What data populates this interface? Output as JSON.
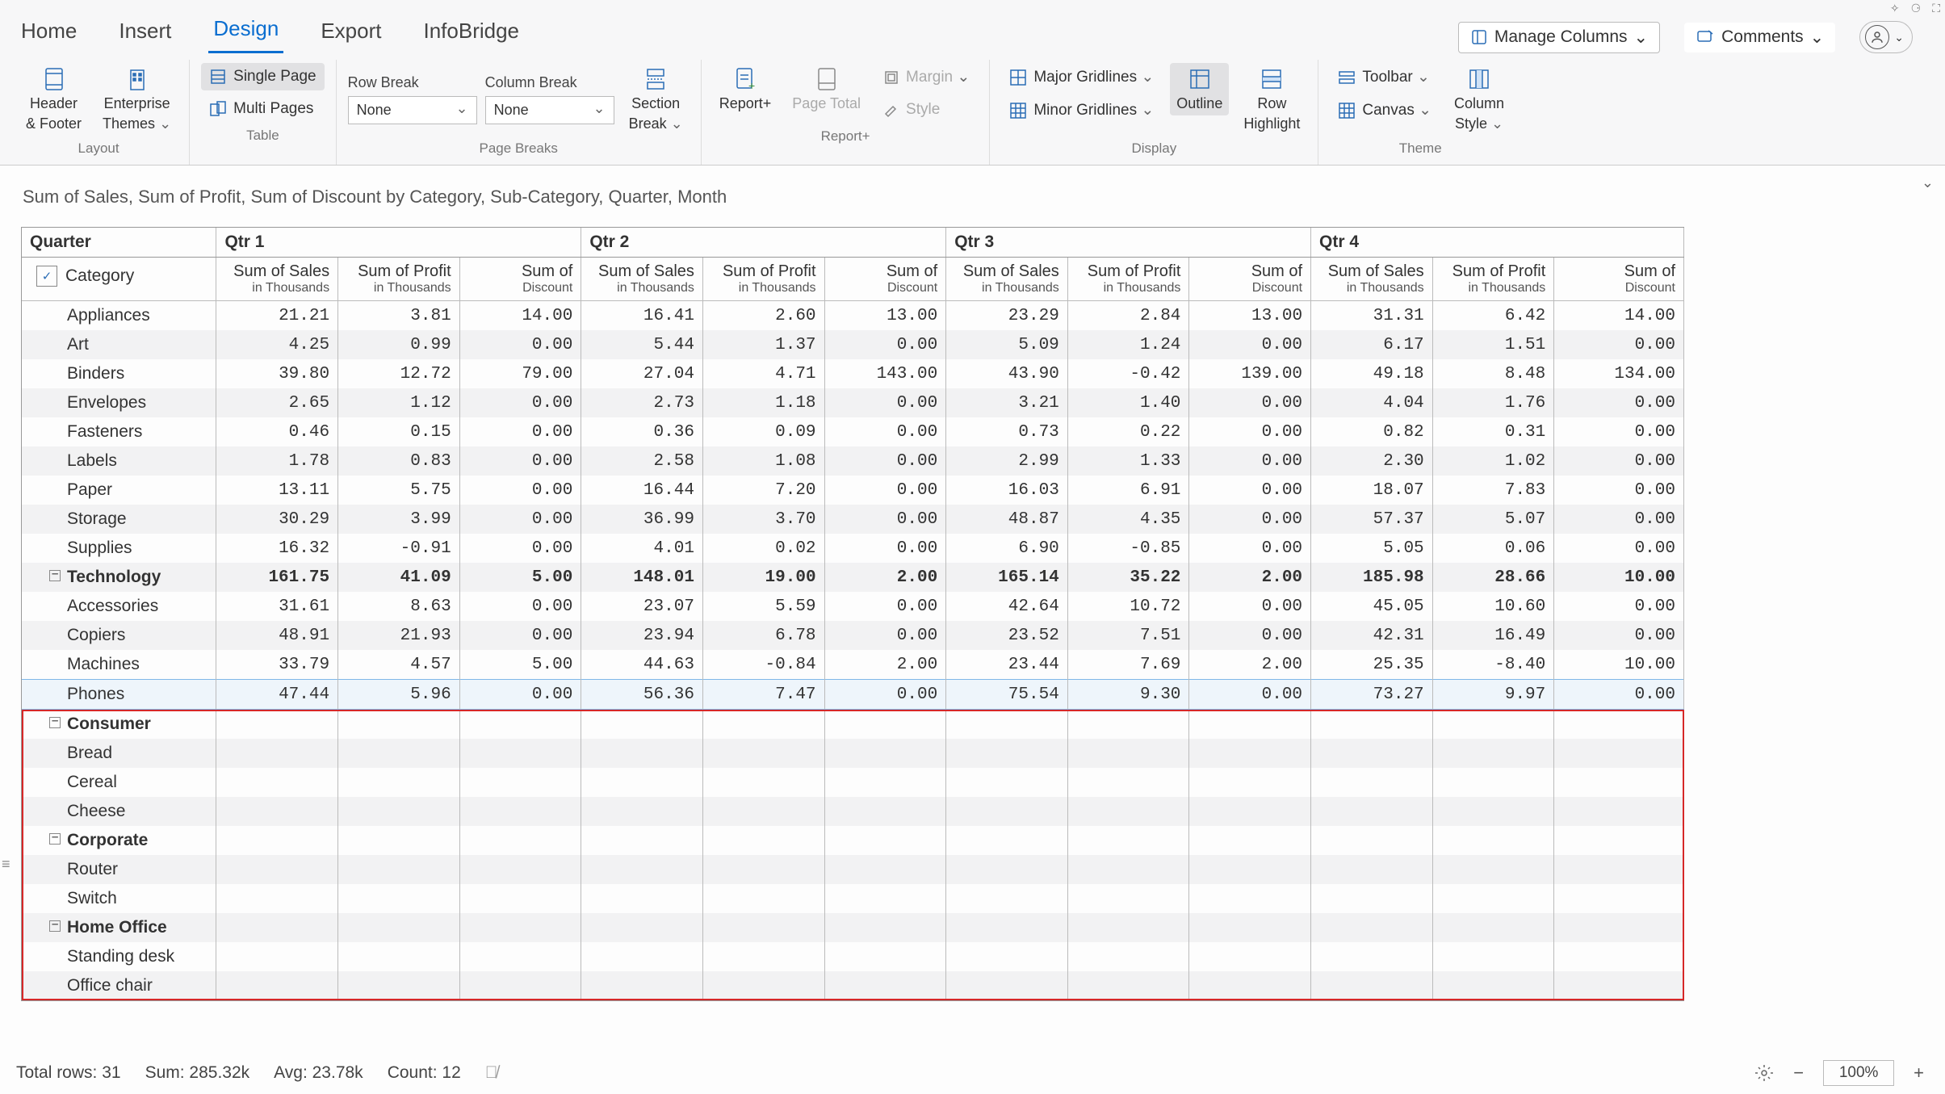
{
  "tabs": [
    "Home",
    "Insert",
    "Design",
    "Export",
    "InfoBridge"
  ],
  "active_tab": "Design",
  "top_controls": {
    "manage_columns": "Manage Columns",
    "comments": "Comments"
  },
  "ribbon": {
    "layout": {
      "header_footer": [
        "Header",
        "& Footer"
      ],
      "enterprise_themes": [
        "Enterprise",
        "Themes"
      ],
      "label": "Layout"
    },
    "table": {
      "single_page": "Single Page",
      "multi_pages": "Multi Pages",
      "label": "Table"
    },
    "page_breaks": {
      "row_break": "Row Break",
      "column_break": "Column Break",
      "none1": "None",
      "none2": "None",
      "section_break": [
        "Section",
        "Break"
      ],
      "label": "Page Breaks"
    },
    "report_plus": {
      "report": "Report+",
      "page_total": "Page Total",
      "margin": "Margin",
      "style": "Style",
      "label": "Report+"
    },
    "display": {
      "major": "Major Gridlines",
      "minor": "Minor Gridlines",
      "outline": "Outline",
      "row_highlight": [
        "Row",
        "Highlight"
      ],
      "label": "Display"
    },
    "theme": {
      "toolbar": "Toolbar",
      "canvas": "Canvas",
      "column_style": [
        "Column",
        "Style"
      ],
      "label": "Theme"
    }
  },
  "report_title": "Sum of Sales, Sum of Profit, Sum of Discount by Category, Sub-Category, Quarter, Month",
  "quarter_label": "Quarter",
  "category_label": "Category",
  "quarters": [
    "Qtr 1",
    "Qtr 2",
    "Qtr 3",
    "Qtr 4"
  ],
  "measures": [
    {
      "t": "Sum of Sales",
      "s": "in Thousands"
    },
    {
      "t": "Sum of Profit",
      "s": "in Thousands"
    },
    {
      "t": "Sum of",
      "s": "Discount"
    }
  ],
  "rows": [
    {
      "label": "Appliances",
      "lvl": 1,
      "v": [
        "21.21",
        "3.81",
        "14.00",
        "16.41",
        "2.60",
        "13.00",
        "23.29",
        "2.84",
        "13.00",
        "31.31",
        "6.42",
        "14.00"
      ]
    },
    {
      "label": "Art",
      "lvl": 1,
      "v": [
        "4.25",
        "0.99",
        "0.00",
        "5.44",
        "1.37",
        "0.00",
        "5.09",
        "1.24",
        "0.00",
        "6.17",
        "1.51",
        "0.00"
      ]
    },
    {
      "label": "Binders",
      "lvl": 1,
      "v": [
        "39.80",
        "12.72",
        "79.00",
        "27.04",
        "4.71",
        "143.00",
        "43.90",
        "-0.42",
        "139.00",
        "49.18",
        "8.48",
        "134.00"
      ]
    },
    {
      "label": "Envelopes",
      "lvl": 1,
      "v": [
        "2.65",
        "1.12",
        "0.00",
        "2.73",
        "1.18",
        "0.00",
        "3.21",
        "1.40",
        "0.00",
        "4.04",
        "1.76",
        "0.00"
      ]
    },
    {
      "label": "Fasteners",
      "lvl": 1,
      "v": [
        "0.46",
        "0.15",
        "0.00",
        "0.36",
        "0.09",
        "0.00",
        "0.73",
        "0.22",
        "0.00",
        "0.82",
        "0.31",
        "0.00"
      ]
    },
    {
      "label": "Labels",
      "lvl": 1,
      "v": [
        "1.78",
        "0.83",
        "0.00",
        "2.58",
        "1.08",
        "0.00",
        "2.99",
        "1.33",
        "0.00",
        "2.30",
        "1.02",
        "0.00"
      ]
    },
    {
      "label": "Paper",
      "lvl": 1,
      "v": [
        "13.11",
        "5.75",
        "0.00",
        "16.44",
        "7.20",
        "0.00",
        "16.03",
        "6.91",
        "0.00",
        "18.07",
        "7.83",
        "0.00"
      ]
    },
    {
      "label": "Storage",
      "lvl": 1,
      "v": [
        "30.29",
        "3.99",
        "0.00",
        "36.99",
        "3.70",
        "0.00",
        "48.87",
        "4.35",
        "0.00",
        "57.37",
        "5.07",
        "0.00"
      ]
    },
    {
      "label": "Supplies",
      "lvl": 1,
      "v": [
        "16.32",
        "-0.91",
        "0.00",
        "4.01",
        "0.02",
        "0.00",
        "6.90",
        "-0.85",
        "0.00",
        "5.05",
        "0.06",
        "0.00"
      ]
    },
    {
      "label": "Technology",
      "lvl": 0,
      "bold": true,
      "v": [
        "161.75",
        "41.09",
        "5.00",
        "148.01",
        "19.00",
        "2.00",
        "165.14",
        "35.22",
        "2.00",
        "185.98",
        "28.66",
        "10.00"
      ]
    },
    {
      "label": "Accessories",
      "lvl": 1,
      "v": [
        "31.61",
        "8.63",
        "0.00",
        "23.07",
        "5.59",
        "0.00",
        "42.64",
        "10.72",
        "0.00",
        "45.05",
        "10.60",
        "0.00"
      ]
    },
    {
      "label": "Copiers",
      "lvl": 1,
      "v": [
        "48.91",
        "21.93",
        "0.00",
        "23.94",
        "6.78",
        "0.00",
        "23.52",
        "7.51",
        "0.00",
        "42.31",
        "16.49",
        "0.00"
      ]
    },
    {
      "label": "Machines",
      "lvl": 1,
      "v": [
        "33.79",
        "4.57",
        "5.00",
        "44.63",
        "-0.84",
        "2.00",
        "23.44",
        "7.69",
        "2.00",
        "25.35",
        "-8.40",
        "10.00"
      ]
    },
    {
      "label": "Phones",
      "lvl": 1,
      "sel": true,
      "v": [
        "47.44",
        "5.96",
        "0.00",
        "56.36",
        "7.47",
        "0.00",
        "75.54",
        "9.30",
        "0.00",
        "73.27",
        "9.97",
        "0.00"
      ]
    }
  ],
  "empty_rows": [
    {
      "label": "Consumer",
      "lvl": 0,
      "bold": true
    },
    {
      "label": "Bread",
      "lvl": 1
    },
    {
      "label": "Cereal",
      "lvl": 1
    },
    {
      "label": "Cheese",
      "lvl": 1
    },
    {
      "label": "Corporate",
      "lvl": 0,
      "bold": true
    },
    {
      "label": "Router",
      "lvl": 1
    },
    {
      "label": "Switch",
      "lvl": 1
    },
    {
      "label": "Home Office",
      "lvl": 0,
      "bold": true
    },
    {
      "label": "Standing desk",
      "lvl": 1
    },
    {
      "label": "Office chair",
      "lvl": 1
    }
  ],
  "status": {
    "total_rows": "Total rows: 31",
    "sum": "Sum: 285.32k",
    "avg": "Avg: 23.78k",
    "count": "Count: 12",
    "zoom": "100%"
  }
}
